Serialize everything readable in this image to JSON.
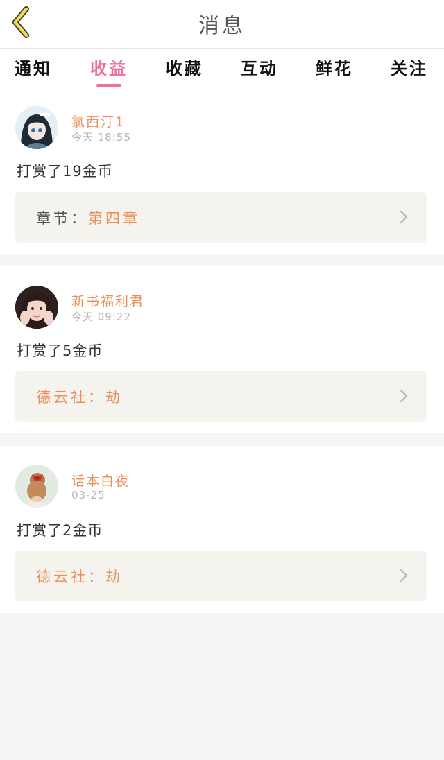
{
  "header": {
    "title": "消息",
    "back_icon": "chevron-left-icon"
  },
  "tabs": [
    {
      "label": "通知",
      "active": false
    },
    {
      "label": "收益",
      "active": true
    },
    {
      "label": "收藏",
      "active": false
    },
    {
      "label": "互动",
      "active": false
    },
    {
      "label": "鲜花",
      "active": false
    },
    {
      "label": "关注",
      "active": false
    }
  ],
  "messages": [
    {
      "username": "氯西汀1",
      "time": "今天  18:55",
      "reward": "打赏了19金币",
      "link_label": "章节：",
      "link_value": "第四章"
    },
    {
      "username": "新书福利君",
      "time": "今天  09:22",
      "reward": "打赏了5金币",
      "link_label": "德云社：",
      "link_value": "劫"
    },
    {
      "username": "话本白夜",
      "time": "03-25",
      "reward": "打赏了2金币",
      "link_label": "德云社：",
      "link_value": "劫"
    }
  ],
  "colors": {
    "accent": "#ec6fa0",
    "username": "#e8905b",
    "link_bg": "#f4f3ee"
  }
}
